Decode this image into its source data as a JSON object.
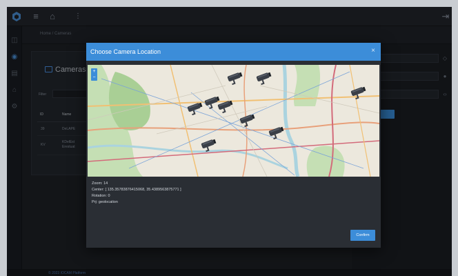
{
  "app": {
    "breadcrumb": "Home / Cameras",
    "footer_text": "© 2023 IOCAM Platform"
  },
  "cameras_card": {
    "title": "Cameras",
    "filter_label": "Filter",
    "columns": [
      "ID",
      "Name"
    ],
    "rows": [
      {
        "id": "39",
        "name": "DeLAPE"
      },
      {
        "id": "KV",
        "name": "KDelEst\nErestuat"
      }
    ]
  },
  "modal": {
    "title": "Choose Camera Location",
    "zoom_in": "+",
    "zoom_out": "−",
    "info": {
      "zoom": "Zoom: 14",
      "center": "Center: [ 135.35783876415068, 35.4389563875771 ]",
      "rotation": "Rotation: 0",
      "projection": "Prj: geolocation"
    },
    "confirm_label": "Confirm"
  },
  "colors": {
    "accent": "#3c8dd9",
    "background": "#1e2126",
    "panel": "#2a2e34"
  },
  "icons": {
    "logo": "hexagon-logo-icon",
    "menu": "hamburger-icon",
    "home": "home-icon",
    "logout": "logout-icon",
    "camera": "camera-icon"
  }
}
